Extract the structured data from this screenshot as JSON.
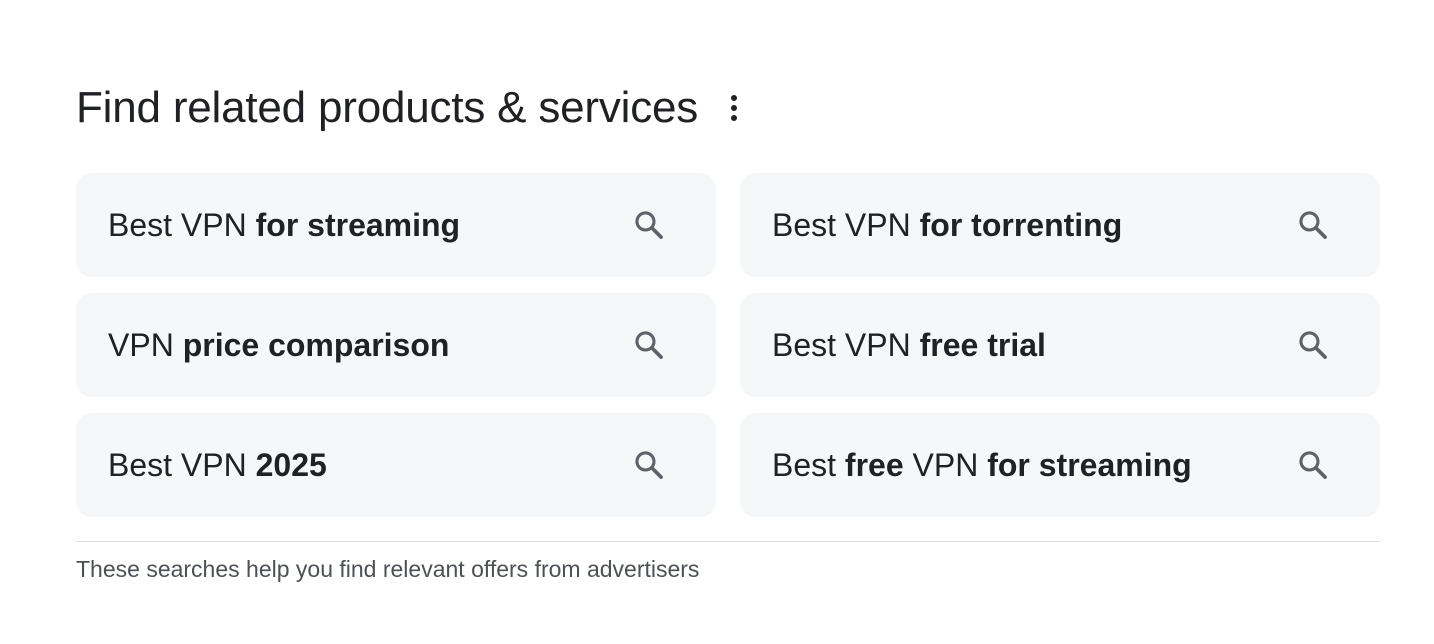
{
  "header": {
    "title": "Find related products & services",
    "more_icon": "more-vert-icon"
  },
  "searches": [
    {
      "segments": [
        {
          "text": "Best VPN ",
          "bold": false
        },
        {
          "text": "for streaming",
          "bold": true
        }
      ],
      "icon": "search-icon"
    },
    {
      "segments": [
        {
          "text": "Best VPN ",
          "bold": false
        },
        {
          "text": "for torrenting",
          "bold": true
        }
      ],
      "icon": "search-icon"
    },
    {
      "segments": [
        {
          "text": "VPN ",
          "bold": false
        },
        {
          "text": "price comparison",
          "bold": true
        }
      ],
      "icon": "search-icon"
    },
    {
      "segments": [
        {
          "text": "Best VPN ",
          "bold": false
        },
        {
          "text": "free trial",
          "bold": true
        }
      ],
      "icon": "search-icon"
    },
    {
      "segments": [
        {
          "text": "Best VPN ",
          "bold": false
        },
        {
          "text": "2025",
          "bold": true
        }
      ],
      "icon": "search-icon"
    },
    {
      "segments": [
        {
          "text": "Best ",
          "bold": false
        },
        {
          "text": "free",
          "bold": true
        },
        {
          "text": " VPN ",
          "bold": false
        },
        {
          "text": "for streaming",
          "bold": true
        }
      ],
      "icon": "search-icon"
    }
  ],
  "footer": {
    "note": "These searches help you find relevant offers from advertisers"
  },
  "colors": {
    "chip_background": "#f6f7f9",
    "text": "#202124",
    "icon": "#5f6368",
    "footer_text": "#4d5156",
    "divider": "#dadce0"
  }
}
